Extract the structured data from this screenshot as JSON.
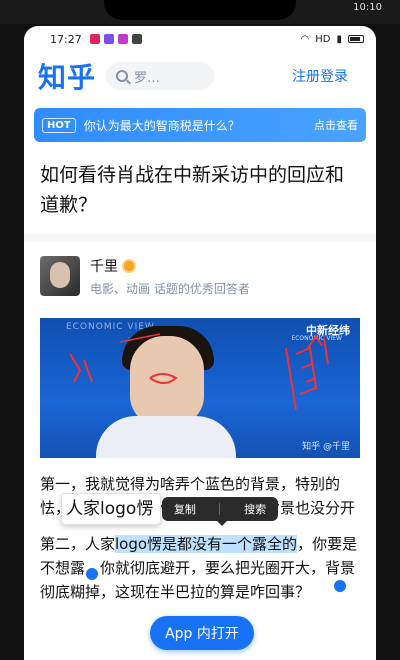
{
  "outer_status": {
    "time": "10:10"
  },
  "status_bar": {
    "time": "17:27",
    "network": "HD"
  },
  "header": {
    "logo": "知乎",
    "search_placeholder": "罗…",
    "login": "注册登录"
  },
  "banner": {
    "tag": "HOT",
    "text": "你认为最大的智商税是什么？",
    "action": "点击查看"
  },
  "question": {
    "title": "如何看待肖战在中新采访中的回应和道歉？"
  },
  "author": {
    "name": "千里",
    "description": "电影、动画 话题的优秀回答者"
  },
  "photo": {
    "watermark": "ECONOMIC VIEW",
    "brand": "中新经纬",
    "brand_sub": "ECONOMIC VIEW",
    "credit": "知乎 @千里"
  },
  "article": {
    "p1": "第一，我就觉得为啥弄个蓝色的背景，特别的怯，颜色特别夺主体人物，人物和背景也没分开",
    "p2_before": "第二，人家",
    "p2_selected": "logo愣是都没有一个露全的",
    "p2_after": "，你要是不想露，你就彻底避开，要么把光圈开大，背景彻底糊掉，这现在半巴拉的算是咋回事？"
  },
  "selection": {
    "copy": "复制",
    "search": "搜索",
    "magnifier_text": "人家logo愣"
  },
  "app_button": {
    "label": "App 内打开"
  },
  "colors": {
    "brand": "#1772f6",
    "selection": "#bfe0ff"
  }
}
